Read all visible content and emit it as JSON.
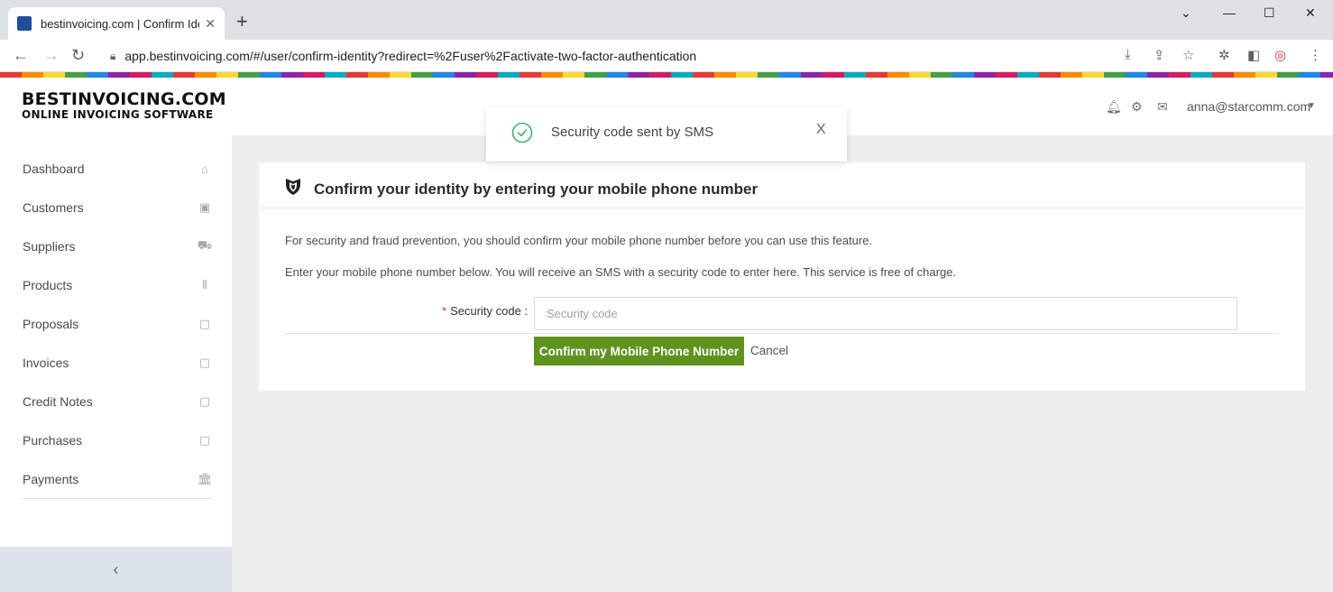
{
  "browser": {
    "tab_title": "bestinvoicing.com | Confirm Iden",
    "url": "app.bestinvoicing.com/#/user/confirm-identity?redirect=%2Fuser%2Factivate-two-factor-authentication"
  },
  "brand": {
    "line1": "BESTINVOICING.COM",
    "line2": "ONLINE INVOICING SOFTWARE"
  },
  "header": {
    "user_email": "anna@starcomm.com"
  },
  "sidebar": {
    "items": [
      {
        "label": "Dashboard",
        "icon": "home-icon"
      },
      {
        "label": "Customers",
        "icon": "contact-card-icon"
      },
      {
        "label": "Suppliers",
        "icon": "truck-icon"
      },
      {
        "label": "Products",
        "icon": "barcode-icon"
      },
      {
        "label": "Proposals",
        "icon": "pdf-icon"
      },
      {
        "label": "Invoices",
        "icon": "pdf-icon"
      },
      {
        "label": "Credit Notes",
        "icon": "pdf-icon"
      },
      {
        "label": "Purchases",
        "icon": "pdf-icon"
      },
      {
        "label": "Payments",
        "icon": "bank-icon"
      }
    ]
  },
  "toast": {
    "message": "Security code sent by SMS",
    "close": "X"
  },
  "card": {
    "title": "Confirm your identity by entering your mobile phone number",
    "para1": "For security and fraud prevention, you should confirm your mobile phone number before you can use this feature.",
    "para2": "Enter your mobile phone number below. You will receive an SMS with a security code to enter here. This service is free of charge.",
    "field_label": "Security code",
    "field_placeholder": "Security code",
    "field_value": "",
    "confirm_label": "Confirm my Mobile Phone Number",
    "cancel_label": "Cancel"
  },
  "colors": {
    "accent_green": "#5f931e",
    "success_green": "#3fb56b"
  }
}
